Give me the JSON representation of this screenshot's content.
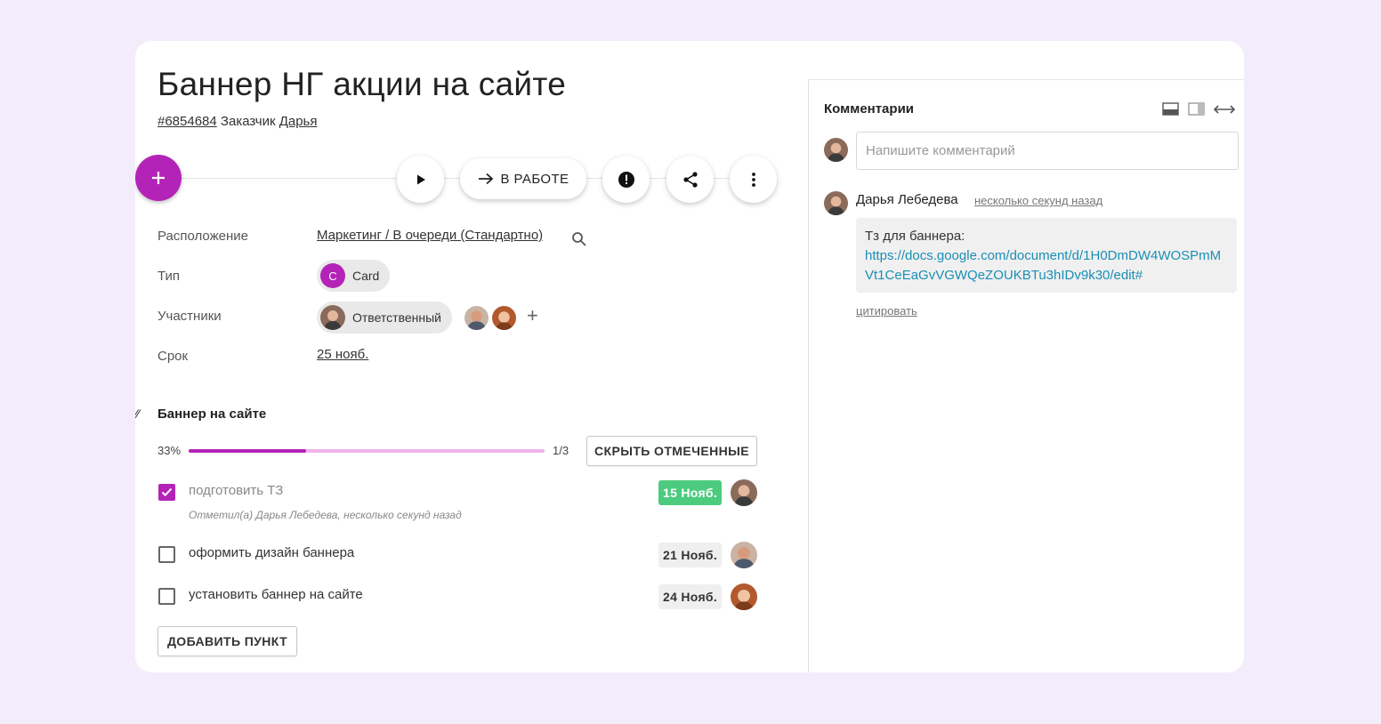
{
  "task": {
    "title": "Баннер НГ акции на сайте",
    "id": "#6854684",
    "customer_label": "Заказчик",
    "customer_name": "Дарья"
  },
  "toolbar": {
    "add_icon": "plus-icon",
    "play_icon": "play-icon",
    "status_label": "В РАБОТЕ",
    "status_icon": "arrow-right-icon",
    "priority_icon": "exclamation-icon",
    "share_icon": "share-icon",
    "more_icon": "more-vertical-icon"
  },
  "properties": {
    "location_label": "Расположение",
    "location_value": "Маркетинг / В очереди (Стандартно)",
    "type_label": "Тип",
    "type_letter": "C",
    "type_value": "Card",
    "participants_label": "Участники",
    "responsible_label": "Ответственный",
    "add_participant": "+",
    "due_label": "Срок",
    "due_value": "25 нояб."
  },
  "checklist": {
    "title": "Баннер на сайте",
    "progress_percent": "33%",
    "progress_value": 0.33,
    "progress_fraction": "1/3",
    "hide_button": "СКРЫТЬ ОТМЕЧЕННЫЕ",
    "add_button": "ДОБАВИТЬ ПУНКТ",
    "items": [
      {
        "text": "подготовить ТЗ",
        "checked": true,
        "date": "15 Нояб.",
        "date_color": "#4ccb7e",
        "meta": "Отметил(а) Дарья Лебедева, несколько секунд назад"
      },
      {
        "text": "оформить дизайн баннера",
        "checked": false,
        "date": "21 Нояб."
      },
      {
        "text": "установить баннер на сайте",
        "checked": false,
        "date": "24 Нояб."
      }
    ]
  },
  "comments": {
    "title": "Комментарии",
    "placeholder": "Напишите комментарий",
    "items": [
      {
        "author": "Дарья Лебедева",
        "time": "несколько секунд назад",
        "text": "Тз для баннера:",
        "link": "https://docs.google.com/document/d/1H0DmDW4WOSPmMVt1CeEaGvVGWQeZOUKBTu3hIDv9k30/edit#",
        "quote": "цитировать"
      }
    ]
  },
  "colors": {
    "accent": "#b423b8",
    "progress_track": "#f0b3ec",
    "done_badge": "#4ccb7e",
    "link": "#1a8fb5",
    "background": "#f3ecfb"
  }
}
